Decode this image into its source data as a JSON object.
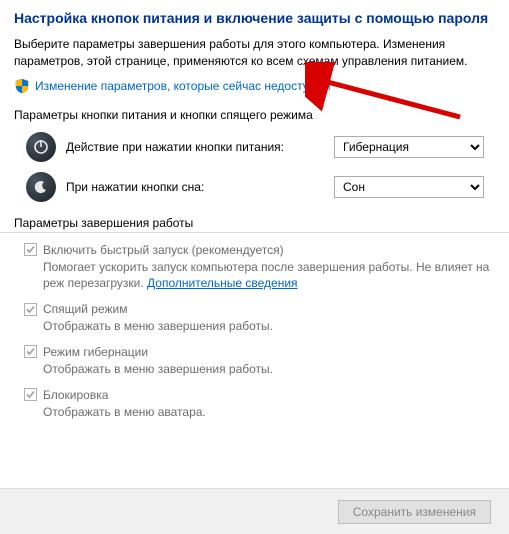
{
  "header": {
    "title": "Настройка кнопок питания и включение защиты с помощью пароля",
    "subtitle": "Выберите параметры завершения работы для этого компьютера. Изменения параметров, этой странице, применяются ко всем схемам управления питанием.",
    "uac_link": "Изменение параметров, которые сейчас недоступны"
  },
  "buttons_section": {
    "label": "Параметры кнопки питания и кнопки спящего режима",
    "power_label": "Действие при нажатии кнопки питания:",
    "power_value": "Гибернация",
    "sleep_label": "При нажатии кнопки сна:",
    "sleep_value": "Сон"
  },
  "shutdown_section": {
    "label": "Параметры завершения работы",
    "options": [
      {
        "title": "Включить быстрый запуск (рекомендуется)",
        "desc_pre": "Помогает ускорить запуск компьютера после завершения работы. Не влияет на реж перезагрузки. ",
        "link": "Дополнительные сведения"
      },
      {
        "title": "Спящий режим",
        "desc": "Отображать в меню завершения работы."
      },
      {
        "title": "Режим гибернации",
        "desc": "Отображать в меню завершения работы."
      },
      {
        "title": "Блокировка",
        "desc": "Отображать в меню аватара."
      }
    ]
  },
  "footer": {
    "save_label": "Сохранить изменения"
  }
}
